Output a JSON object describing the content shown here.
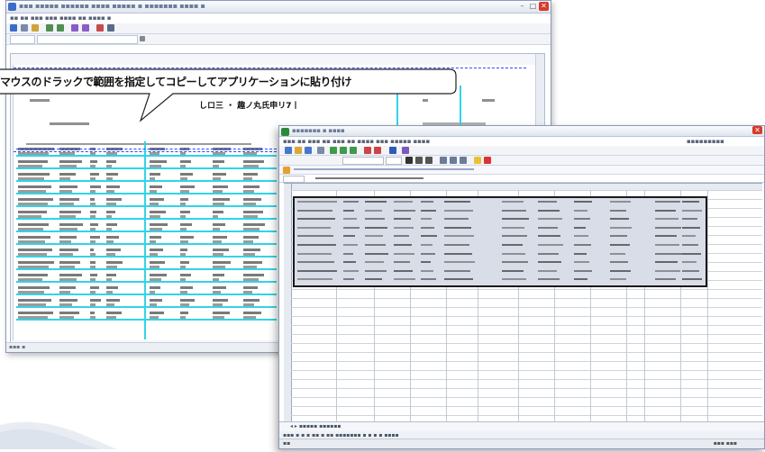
{
  "callout": {
    "text": "マウスのドラックで範囲を指定してコピーしてアプリケーションに貼り付け"
  },
  "document": {
    "heading": "しロ三 ・ 趣ノ丸氏申リ7丨"
  },
  "icons": {
    "close": "close-icon",
    "minimize": "minimize-icon",
    "maximize": "maximize-icon",
    "app": "app-icon"
  },
  "colors": {
    "highlight_lines": "#31d4e6",
    "dashed_line": "#2b48ff",
    "selection_border": "#1a1a1a"
  }
}
